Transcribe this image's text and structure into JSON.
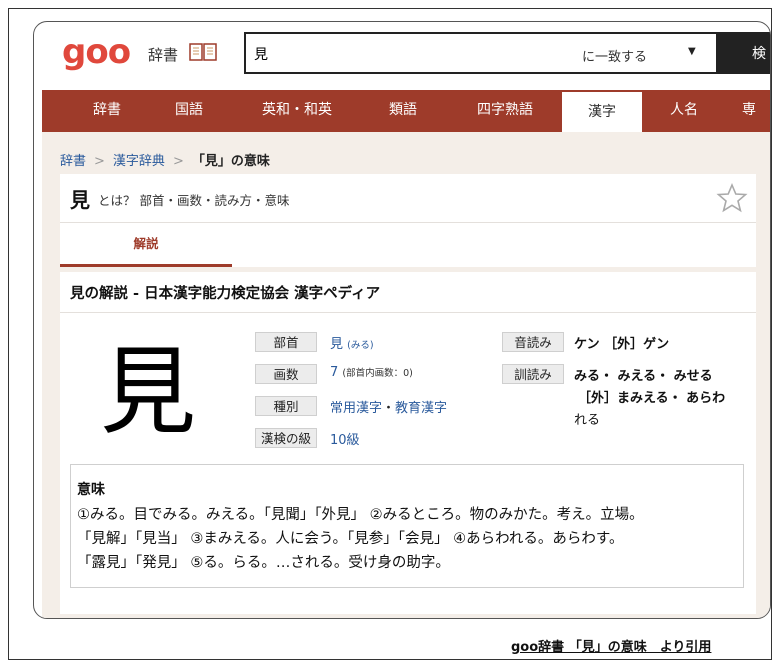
{
  "header": {
    "logo_text": "goo",
    "site_name": "辞書",
    "search_value": "見",
    "match_mode": "に一致する",
    "search_button": "検"
  },
  "nav": {
    "tabs": [
      "辞書",
      "国語",
      "英和・和英",
      "類語",
      "四字熟語",
      "漢字",
      "人名",
      "専"
    ],
    "active": "漢字"
  },
  "breadcrumb": {
    "items": [
      "辞書",
      "漢字辞典"
    ],
    "current": "「見」の意味"
  },
  "entry": {
    "kanji": "見",
    "title_suffix": "とは？ 部首・画数・読み方・意味",
    "tab": "解説",
    "section_title": "見の解説 - 日本漢字能力検定協会 漢字ペディア",
    "big_kanji": "見"
  },
  "info": {
    "bushu_label": "部首",
    "bushu_value": "見",
    "bushu_reading": "(みる)",
    "kakusu_label": "画数",
    "kakusu_value": "7",
    "kakusu_note": "(部首内画数：0)",
    "shubetsu_label": "種別",
    "shubetsu_1": "常用漢字",
    "shubetsu_sep": "・",
    "shubetsu_2": "教育漢字",
    "kanken_label": "漢検の級",
    "kanken_value": "10級",
    "onyomi_label": "音読み",
    "onyomi_value": "ケン ［外］ゲン",
    "kunyomi_label": "訓読み",
    "kunyomi_line1": "みる・ みえる・ みせる",
    "kunyomi_line2": "［外］まみえる・ あらわ",
    "kunyomi_line3": "れる"
  },
  "meaning": {
    "title": "意味",
    "line1": "①みる。目でみる。みえる。「見聞」「外見」 ②みるところ。物のみかた。考え。立場。",
    "line2": "「見解」「見当」 ③まみえる。人に会う。「見参」「会見」 ④あらわれる。あらわす。",
    "line3": "「露見」「発見」 ⑤る。らる。…される。受け身の助字。"
  },
  "citation": "goo辞書 「見」の意味　より引用",
  "colors": {
    "brand": "#e0483c",
    "nav": "#9e3b2a",
    "link": "#2a5a9c"
  }
}
